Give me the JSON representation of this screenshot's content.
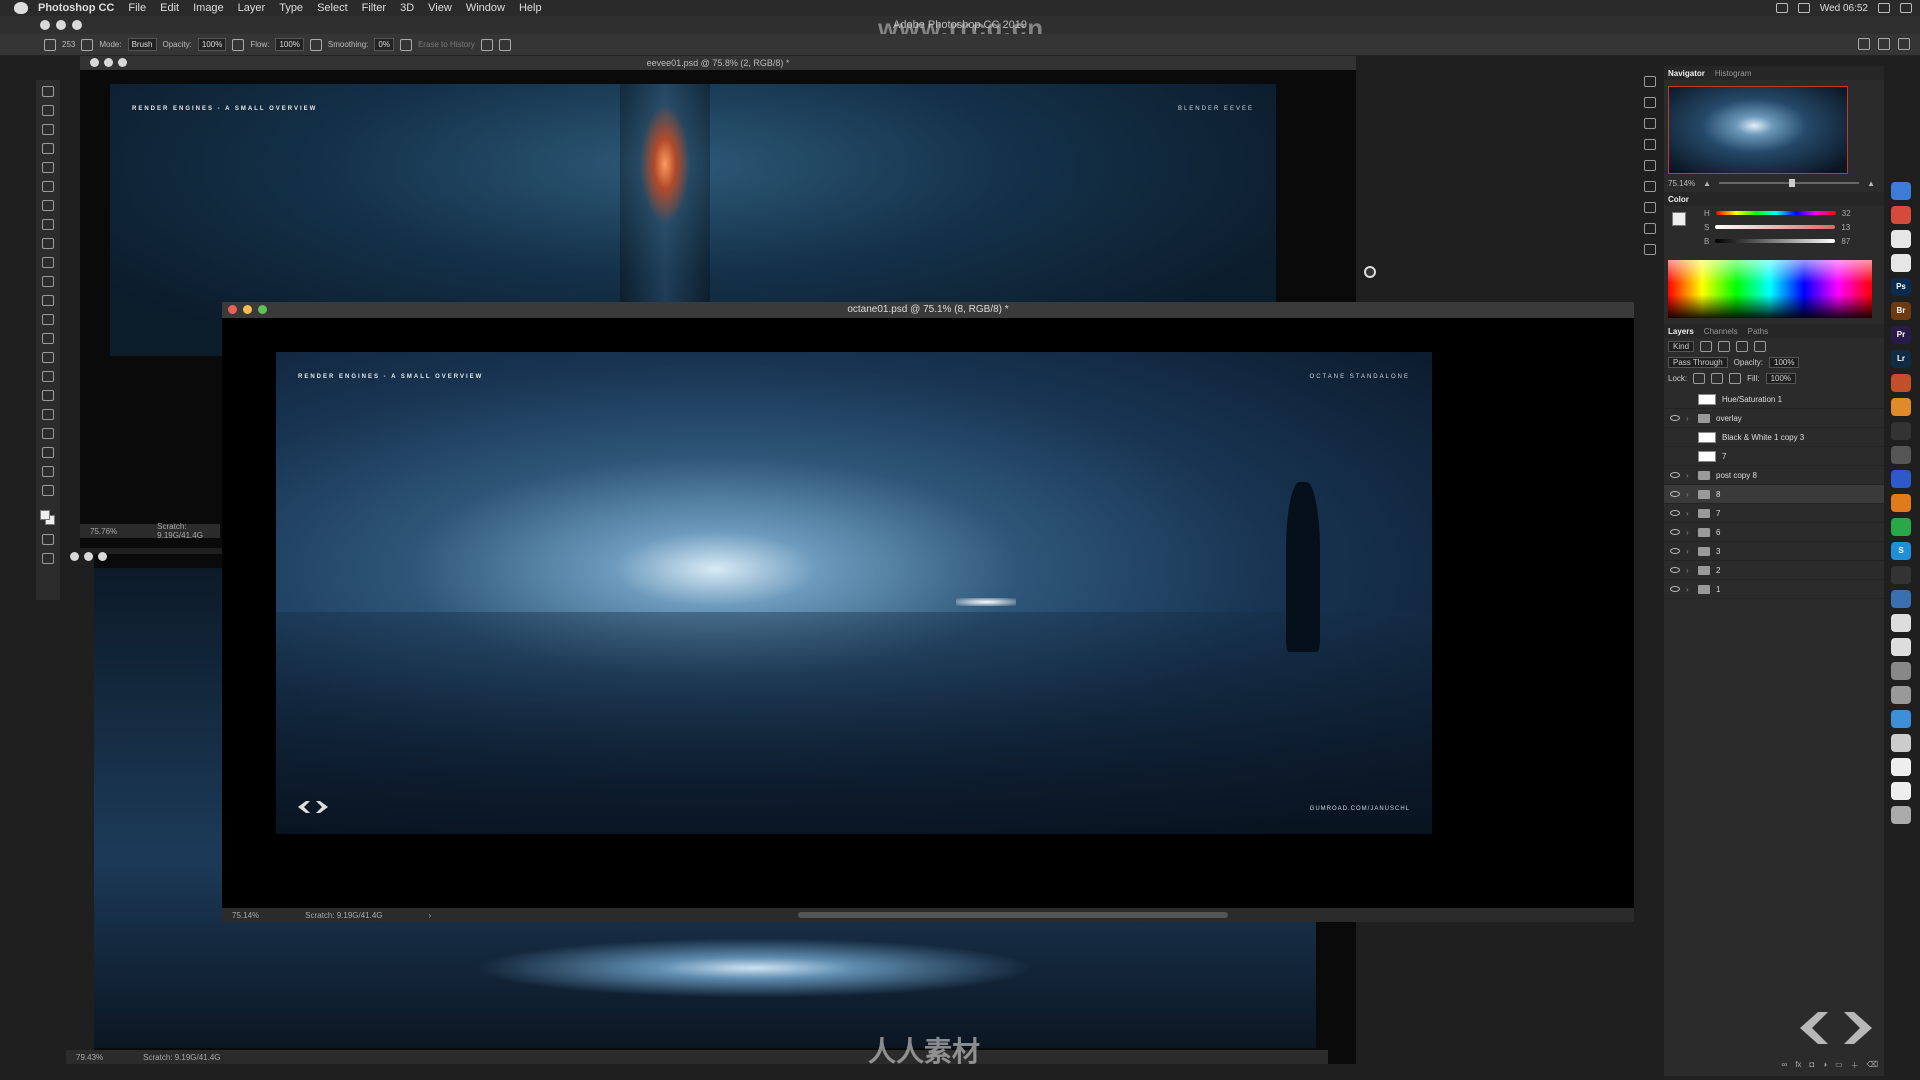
{
  "menubar": {
    "app": "Photoshop CC",
    "items": [
      "File",
      "Edit",
      "Image",
      "Layer",
      "Type",
      "Select",
      "Filter",
      "3D",
      "View",
      "Window",
      "Help"
    ],
    "clock": "Wed 06:52"
  },
  "app_title": "Adobe Photoshop CC 2019",
  "watermark_site": "www.rrcg.cn",
  "options": {
    "brush_size": "253",
    "mode_label": "Mode:",
    "mode_value": "Brush",
    "opacity_label": "Opacity:",
    "opacity_value": "100%",
    "flow_label": "Flow:",
    "flow_value": "100%",
    "smoothing_label": "Smoothing:",
    "smoothing_value": "0%",
    "erase_history": "Erase to History"
  },
  "docs": {
    "a": {
      "title": "eevee01.psd @ 75.8% (2, RGB/8) *",
      "header_left": "RENDER ENGINES - A SMALL OVERVIEW",
      "header_right": "BLENDER EEVEE",
      "zoom": "75.76%",
      "scratch": "Scratch: 9.19G/41.4G"
    },
    "b": {
      "zoom": "79.43%",
      "scratch": "Scratch: 9.19G/41.4G"
    },
    "c": {
      "title": "octane01.psd @ 75.1% (8, RGB/8) *",
      "header_left": "RENDER ENGINES - A SMALL OVERVIEW",
      "header_right": "OCTANE STANDALONE",
      "footer_right": "GUMROAD.COM/JANUSCHL",
      "zoom": "75.14%",
      "scratch": "Scratch: 9.19G/41.4G"
    }
  },
  "navigator": {
    "tab_active": "Navigator",
    "tab_other": "Histogram",
    "zoom": "75.14%"
  },
  "color": {
    "title": "Color",
    "h": "32",
    "s": "13",
    "b": "87"
  },
  "layers_panel": {
    "tabs": [
      "Layers",
      "Channels",
      "Paths"
    ],
    "kind": "Kind",
    "blend": "Pass Through",
    "opacity_label": "Opacity:",
    "opacity": "100%",
    "lock_label": "Lock:",
    "fill_label": "Fill:",
    "fill": "100%",
    "layers": [
      {
        "name": "Hue/Saturation 1",
        "kind": "adjust",
        "visible": false
      },
      {
        "name": "overlay",
        "kind": "folder",
        "visible": true
      },
      {
        "name": "Black & White 1 copy 3",
        "kind": "adjust",
        "visible": false
      },
      {
        "name": "7",
        "kind": "adjust",
        "visible": false
      },
      {
        "name": "post copy 8",
        "kind": "folder",
        "visible": true
      },
      {
        "name": "8",
        "kind": "folder",
        "visible": true,
        "selected": true
      },
      {
        "name": "7",
        "kind": "folder",
        "visible": true
      },
      {
        "name": "6",
        "kind": "folder",
        "visible": true
      },
      {
        "name": "3",
        "kind": "folder",
        "visible": true
      },
      {
        "name": "2",
        "kind": "folder",
        "visible": true
      },
      {
        "name": "1",
        "kind": "folder",
        "visible": true
      }
    ]
  },
  "dock_apps": [
    {
      "label": "",
      "color": "#3d7bd9"
    },
    {
      "label": "",
      "color": "#d44b3c"
    },
    {
      "label": "",
      "color": "#e6e6e6"
    },
    {
      "label": "",
      "color": "#e6e6e6"
    },
    {
      "label": "Ps",
      "color": "#0a2b4e"
    },
    {
      "label": "Br",
      "color": "#6b3a12"
    },
    {
      "label": "Pr",
      "color": "#2a1a4a"
    },
    {
      "label": "Lr",
      "color": "#0f2c44"
    },
    {
      "label": "",
      "color": "#c24f2a"
    },
    {
      "label": "",
      "color": "#e08a2a"
    },
    {
      "label": "",
      "color": "#333333"
    },
    {
      "label": "",
      "color": "#555555"
    },
    {
      "label": "",
      "color": "#2d5ac8"
    },
    {
      "label": "",
      "color": "#e07a1a"
    },
    {
      "label": "",
      "color": "#29a84a"
    },
    {
      "label": "S",
      "color": "#1f8fd8"
    },
    {
      "label": "",
      "color": "#333333"
    },
    {
      "label": "",
      "color": "#3a6fb0"
    },
    {
      "label": "",
      "color": "#dddddd"
    },
    {
      "label": "",
      "color": "#dddddd"
    },
    {
      "label": "",
      "color": "#888888"
    },
    {
      "label": "",
      "color": "#999999"
    },
    {
      "label": "",
      "color": "#3d8fd8"
    },
    {
      "label": "",
      "color": "#cccccc"
    },
    {
      "label": "",
      "color": "#eeeeee"
    },
    {
      "label": "",
      "color": "#eeeeee"
    },
    {
      "label": "",
      "color": "#aaaaaa"
    }
  ],
  "watermark_bottom": "人人素材"
}
